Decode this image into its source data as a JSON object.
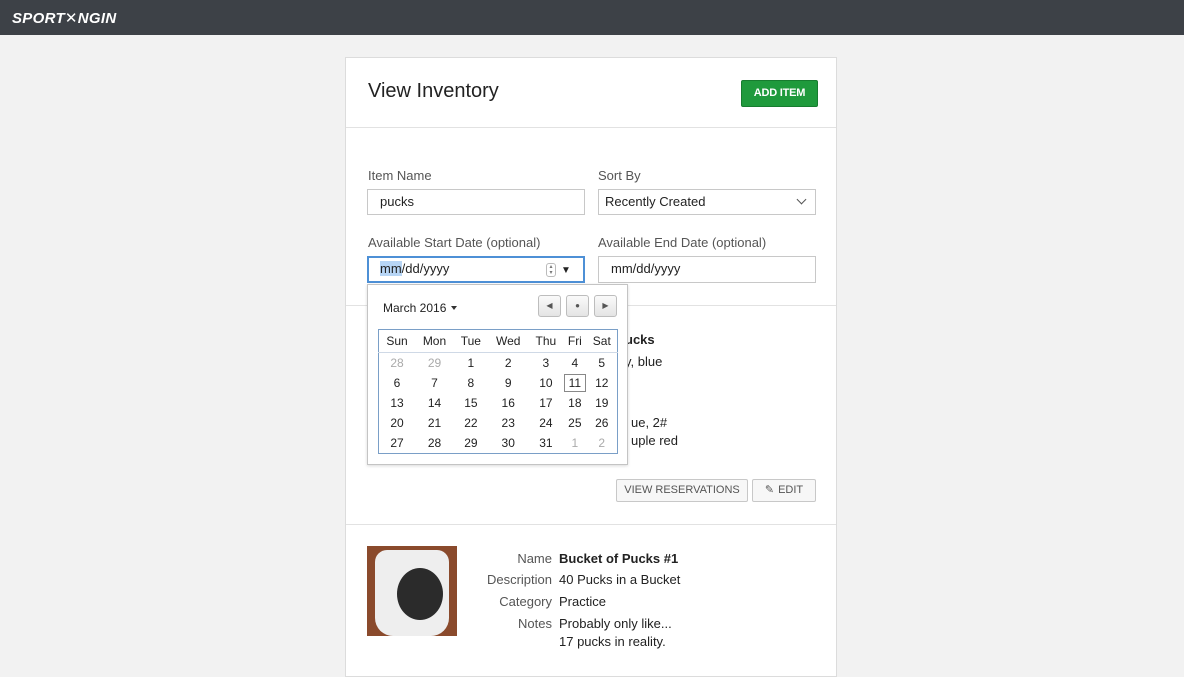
{
  "brand": {
    "logo": "SPORT✕NGIN"
  },
  "header": {
    "title": "View Inventory",
    "add_label": "ADD ITEM"
  },
  "filters": {
    "item_name_label": "Item Name",
    "item_name_value": "pucks",
    "sort_label": "Sort By",
    "sort_value": "Recently Created",
    "start_label": "Available Start Date (optional)",
    "start_value_sel": "mm",
    "start_value_rest": "/dd/yyyy",
    "end_label": "Available End Date (optional)",
    "end_value": "mm/dd/yyyy"
  },
  "datepicker": {
    "month_label": "March 2016",
    "weekdays": [
      "Sun",
      "Mon",
      "Tue",
      "Wed",
      "Thu",
      "Fri",
      "Sat"
    ],
    "weeks": [
      [
        "28",
        "29",
        "1",
        "2",
        "3",
        "4",
        "5"
      ],
      [
        "6",
        "7",
        "8",
        "9",
        "10",
        "11",
        "12"
      ],
      [
        "13",
        "14",
        "15",
        "16",
        "17",
        "18",
        "19"
      ],
      [
        "20",
        "21",
        "22",
        "23",
        "24",
        "25",
        "26"
      ],
      [
        "27",
        "28",
        "29",
        "30",
        "31",
        "1",
        "2"
      ]
    ],
    "today": "11"
  },
  "item1": {
    "partial_name": "ucks",
    "partial_desc": "y, blue",
    "partial_line3": "ue, 2#",
    "partial_line4": "uple red",
    "view_res_label": "VIEW RESERVATIONS",
    "edit_label": "EDIT"
  },
  "item2": {
    "name_key": "Name",
    "name": "Bucket of Pucks #1",
    "desc_key": "Description",
    "desc": "40 Pucks in a Bucket",
    "cat_key": "Category",
    "cat": "Practice",
    "notes_key": "Notes",
    "notes1": "Probably only like...",
    "notes2": "17 pucks in reality."
  }
}
